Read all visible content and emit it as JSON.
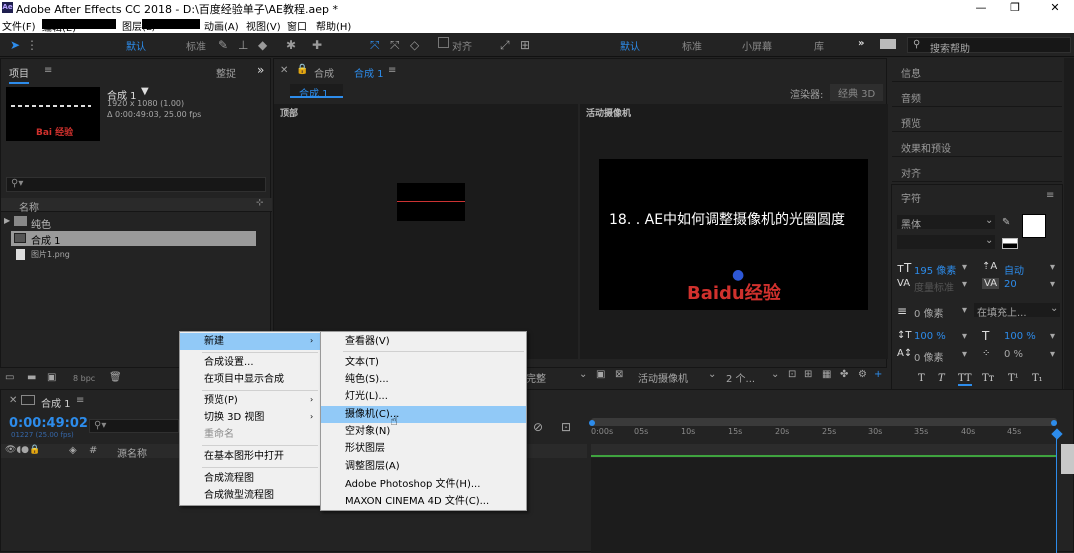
{
  "window": {
    "app_title": "Adobe After Effects CC 2018 - D:\\百度经验单子\\AE教程.aep *",
    "logo": "Ae",
    "minimize": "—",
    "maximize": "❐",
    "close": "✕"
  },
  "menubar": [
    "文件(F)",
    "编辑(E)",
    "图层(L)",
    "动画(A)",
    "视图(V)",
    "窗口",
    "帮助(H)"
  ],
  "toolbar": {
    "default": "默认",
    "standard": "标准",
    "align": "对齐",
    "ws_default": "默认",
    "ws_standard": "标准",
    "ws_small": "小屏幕",
    "ws_lib": "库",
    "search_placeholder": "搜索帮助"
  },
  "project": {
    "tab": "项目",
    "tab2": "整捉",
    "comp_name": "合成 1",
    "comp_size": "1920 x 1080 (1.00)",
    "comp_duration": "Δ 0:00:49:03, 25.00 fps",
    "col_name": "名称",
    "items": [
      "纯色",
      "合成 1",
      "图片1.png"
    ],
    "bpc": "8 bpc",
    "thumb_text": "Bai 经验"
  },
  "composition": {
    "tab": "合成",
    "tab_active": "合成 1",
    "breadcrumb": "合成 1",
    "renderer_label": "渲染器:",
    "renderer": "经典 3D",
    "view_top": "顶部",
    "view_active": "活动摄像机",
    "title_text": "18. . AE中如何调整摄像机的光圈圆度",
    "brand_text": "Baidu经验",
    "resolution": "完整",
    "camera": "活动摄像机",
    "views": "2 个..."
  },
  "timeline": {
    "comp_tab": "合成 1",
    "timecode": "0:00:49:02",
    "frames": "01227 (25.00 fps)",
    "col_source": "源名称",
    "ticks": [
      "0:00s",
      "05s",
      "10s",
      "15s",
      "20s",
      "25s",
      "30s",
      "35s",
      "40s",
      "45s"
    ]
  },
  "right_panels": [
    "信息",
    "音频",
    "预览",
    "效果和预设",
    "对齐"
  ],
  "character": {
    "title": "字符",
    "font": "黑体",
    "size": "195 像素",
    "leading": "自动",
    "tracking": "度量标准",
    "kerning": "20",
    "line1": "0 像素",
    "fill": "在填充上...",
    "v_scale": "100 %",
    "h_scale": "100 %",
    "baseline": "0 像素",
    "tsume": "0 %"
  },
  "context_menu": [
    "新建",
    "合成设置...",
    "在项目中显示合成",
    "预览(P)",
    "切换 3D 视图",
    "重命名",
    "在基本图形中打开",
    "合成流程图",
    "合成微型流程图"
  ],
  "submenu": [
    "查看器(V)",
    "文本(T)",
    "纯色(S)...",
    "灯光(L)...",
    "摄像机(C)...",
    "空对象(N)",
    "形状图层",
    "调整图层(A)",
    "Adobe Photoshop 文件(H)...",
    "MAXON CINEMA 4D 文件(C)..."
  ]
}
